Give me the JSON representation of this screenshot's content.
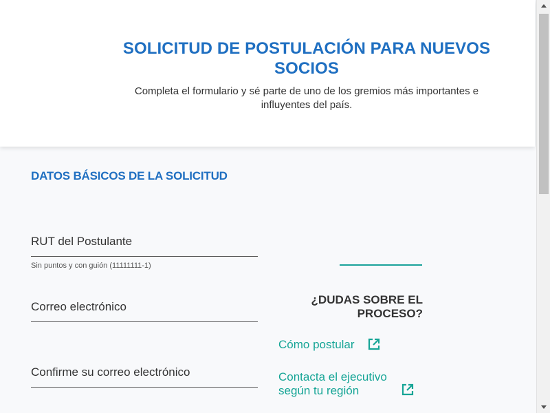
{
  "header": {
    "title": "SOLICITUD DE POSTULACIÓN PARA NUEVOS SOCIOS",
    "subtitle": "Completa el formulario y sé parte de uno de los gremios más importantes e influyentes del país."
  },
  "form": {
    "section_title": "DATOS BÁSICOS DE LA SOLICITUD",
    "fields": [
      {
        "label": "RUT del Postulante",
        "value": "",
        "help": "Sin puntos y con guión (11111111-1)"
      },
      {
        "label": "Correo electrónico",
        "value": ""
      },
      {
        "label": "Confirme su correo electrónico",
        "value": ""
      }
    ]
  },
  "sidebar": {
    "title": "¿DUDAS SOBRE EL PROCESO?",
    "links": [
      {
        "label": "Cómo postular",
        "icon": "external-link-icon"
      },
      {
        "label": "Contacta el ejecutivo según tu región",
        "icon": "external-link-icon"
      }
    ]
  },
  "colors": {
    "primary": "#1f6fc1",
    "accent": "#16a596",
    "rule": "#1aa39a"
  }
}
